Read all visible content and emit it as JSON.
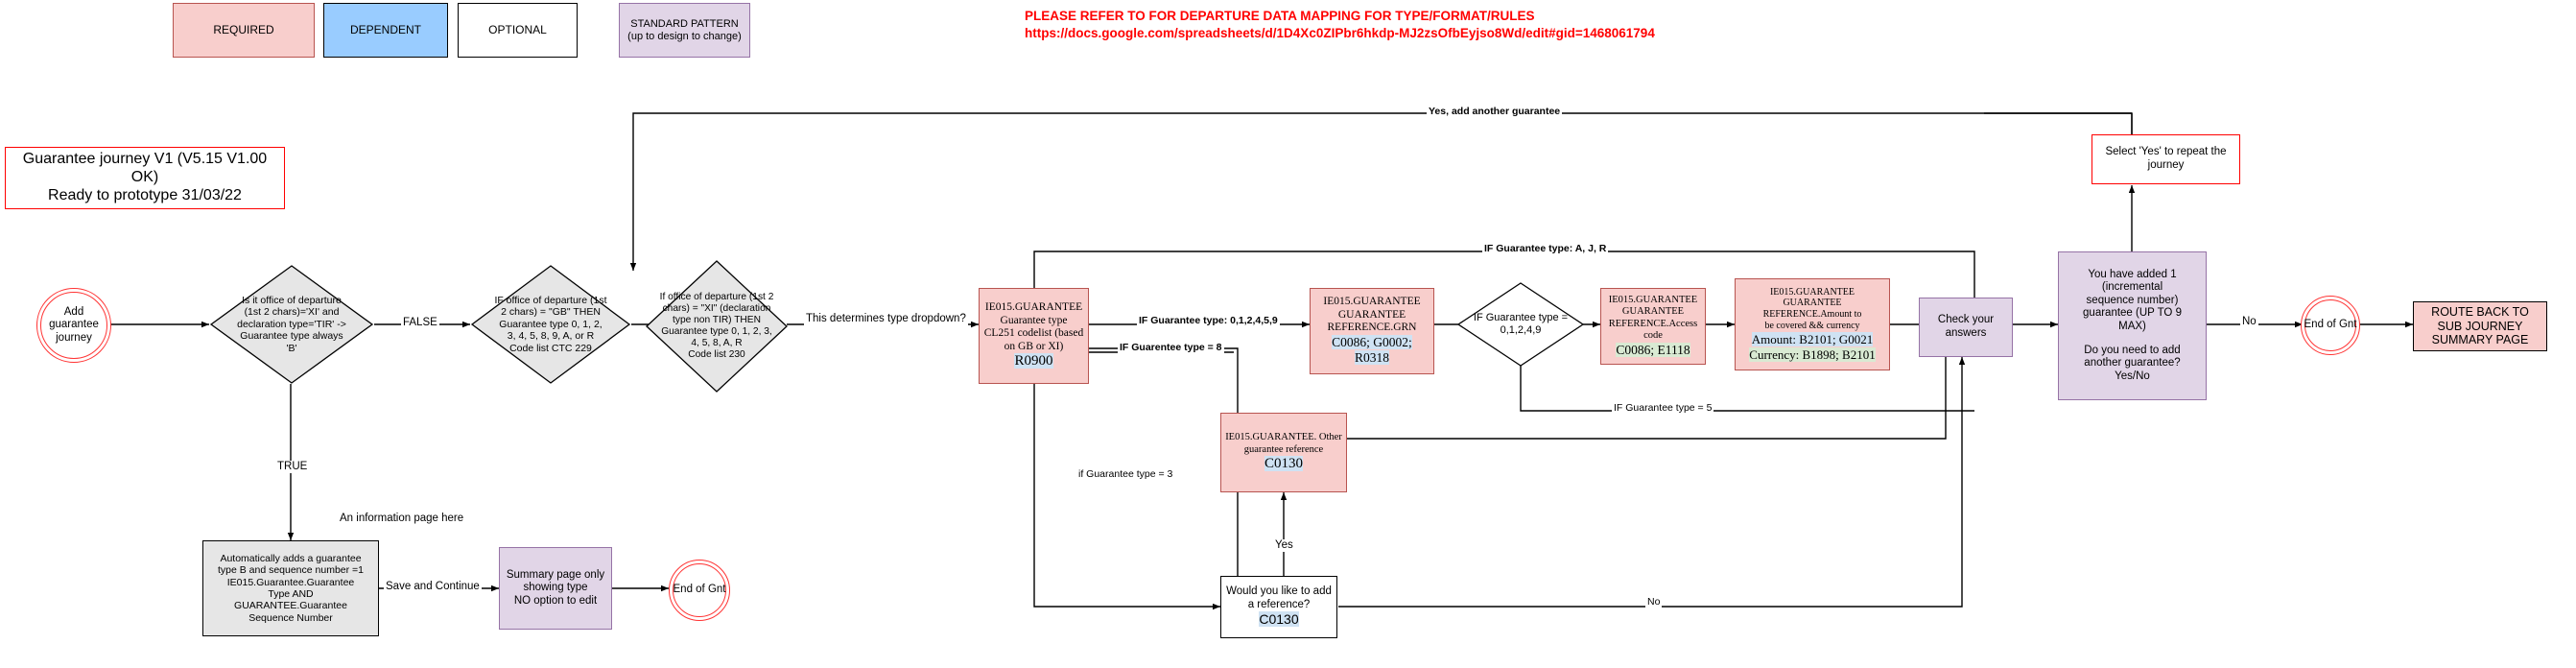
{
  "legend": {
    "items": [
      {
        "label": "REQUIRED",
        "style": "required",
        "color": "#f8cecc"
      },
      {
        "label": "DEPENDENT",
        "style": "dependent",
        "color": "#99ccff"
      },
      {
        "label": "OPTIONAL",
        "style": "optional",
        "color": "#ffffff"
      },
      {
        "label": "STANDARD PATTERN\n(up to design to change)",
        "style": "standard",
        "color": "#e1d5e7"
      }
    ]
  },
  "banner": {
    "line1": "PLEASE REFER TO FOR DEPARTURE DATA MAPPING FOR TYPE/FORMAT/RULES",
    "line2": "https://docs.google.com/spreadsheets/d/1D4Xc0ZIPbr6hkdp-MJ2zsOfbEyjso8Wd/edit#gid=1468061794",
    "color": "#ff0000"
  },
  "title_box": {
    "line1": "Guarantee journey V1 (V5.15 V1.00",
    "line2": "OK)",
    "line3": "Ready to prototype 31/03/22"
  },
  "nodes": {
    "start": {
      "label": "Add\nguarantee\njourney"
    },
    "decision_tir": {
      "l1": "Is it office of departure",
      "l2": "(1st 2 chars)='XI' and",
      "l3": "declaration type='TIR' ->",
      "l4": "Guarantee type always",
      "l5": "'B'"
    },
    "decision_gb": {
      "l1": "IF office of departure (1st",
      "l2": "2 chars) = \"GB\" THEN",
      "l3": "Guarantee type 0, 1, 2,",
      "l4": "3, 4, 5, 8, 9, A,  or R",
      "l5": "Code list CTC 229"
    },
    "decision_xi": {
      "l1": "If office of departure (1st 2",
      "l2": "chars) = \"XI\" (declaration",
      "l3": "type non TIR) THEN",
      "l4": "Guarantee type  0, 1, 2, 3,",
      "l5": "4, 5, 8, A, R",
      "l6": "Code list 230"
    },
    "auto_type_b": {
      "l1": "Automatically adds a guarantee",
      "l2": "type B and sequence number =1",
      "l3": "IE015.Guarantee.Guarantee",
      "l4": "Type AND",
      "l5": "GUARANTEE.Guarantee",
      "l6": "Sequence Number"
    },
    "summary_page": {
      "l1": "Summary page only",
      "l2": "showing type",
      "l3": "NO option to edit"
    },
    "end_gnt_lower": {
      "label": "End of Gnt"
    },
    "guarantee_type": {
      "l1": "IE015.GUARANTEE",
      "l2": "Guarantee type",
      "l3": "CL251 codelist (based",
      "l4": "on GB or XI)",
      "code": "R0900"
    },
    "grn": {
      "l1": "IE015.GUARANTEE",
      "l2": "GUARANTEE",
      "l3": "REFERENCE.GRN",
      "code": "C0086; G0002; R0318"
    },
    "decision_type_01249": {
      "l1": "IF Guarantee type =",
      "l2": "0,1,2,4,9"
    },
    "access_code": {
      "l1": "IE015.GUARANTEE",
      "l2": "GUARANTEE",
      "l3": "REFERENCE.Access code",
      "code": "C0086; E1118"
    },
    "amount_currency": {
      "l1": "IE015.GUARANTEE",
      "l2": "GUARANTEE REFERENCE.Amount to",
      "l3": "be covered  && currency",
      "amount": "Amount: B2101; G0021",
      "currency": "Currency: B1898; B2101"
    },
    "other_guarantee_ref": {
      "l1": "IE015.GUARANTEE. Other",
      "l2": "guarantee reference",
      "code": "C0130"
    },
    "add_reference": {
      "l1": "Would you like to add",
      "l2": "a reference?",
      "code": "C0130"
    },
    "check_answers": {
      "label": "Check your answers"
    },
    "added_guarantee": {
      "l1": "You have added 1",
      "l2": "(incremental",
      "l3": "sequence number)",
      "l4": "guarantee (UP TO 9",
      "l5": "MAX)",
      "l6": "Do you need to add",
      "l7": "another guarantee?",
      "l8": "Yes/No"
    },
    "select_yes": {
      "l1": "Select 'Yes' to repeat the",
      "l2": "journey"
    },
    "end_gnt_right": {
      "label": "End of Gnt"
    },
    "route_back": {
      "l1": "ROUTE BACK TO",
      "l2": "SUB JOURNEY",
      "l3": "SUMMARY PAGE"
    }
  },
  "edge_labels": {
    "false": "FALSE",
    "true": "TRUE",
    "info_page": "An information page here",
    "save_continue": "Save and Continue",
    "determines_dropdown": "This determines type dropdown?",
    "type_012459": "IF Guarantee type: 0,1,2,4,5,9",
    "type_8": "IF Guarentee type = 8",
    "type_3": "if Guarantee type = 3",
    "type_ajr": "IF Guarantee type: A, J, R",
    "type_5": "IF Guarantee type = 5",
    "yes_add_another": "Yes, add another guarantee",
    "yes": "Yes",
    "no_lower": "No",
    "no_right": "No"
  }
}
